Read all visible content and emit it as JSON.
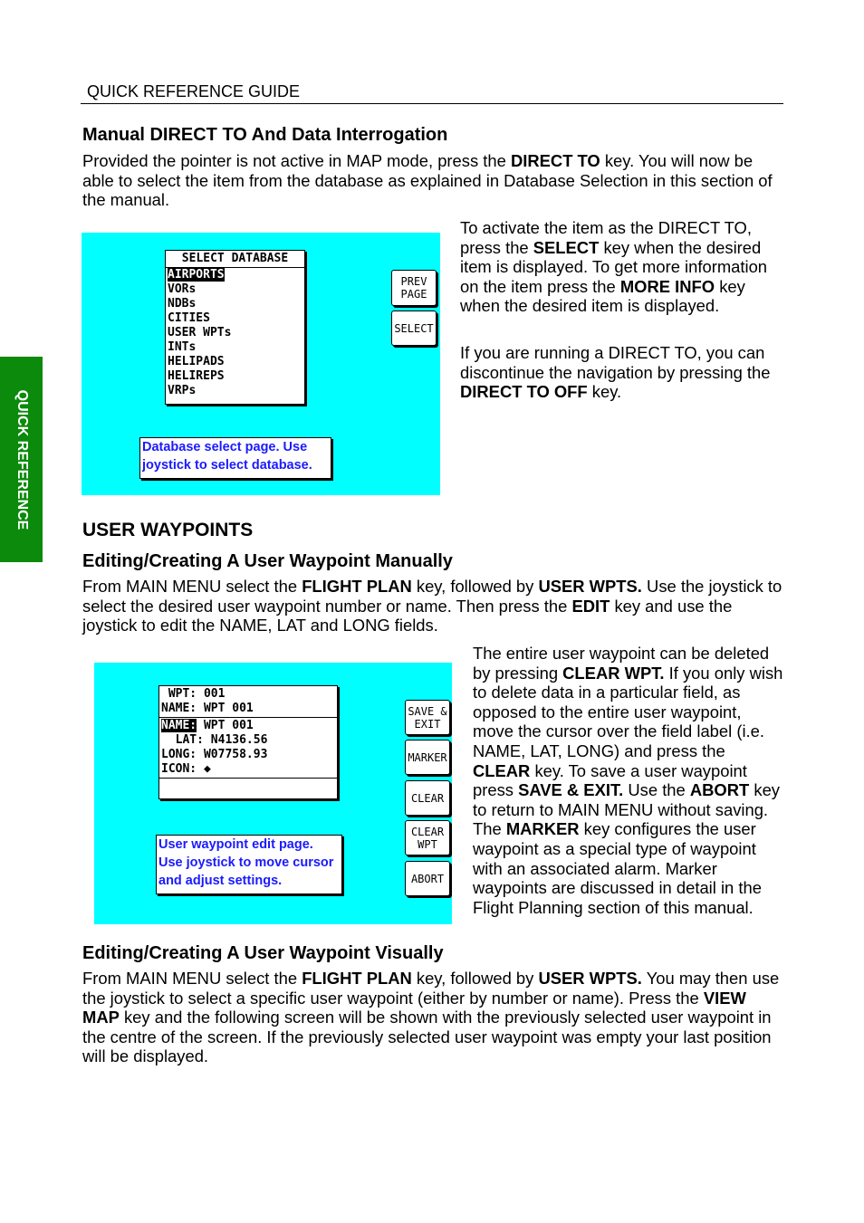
{
  "header": {
    "title": "QUICK REFERENCE GUIDE"
  },
  "side_tab": {
    "label": "QUICK REFERENCE",
    "color": "#0b8a0b"
  },
  "section1": {
    "heading": "Manual DIRECT TO And Data Interrogation",
    "intro": [
      {
        "t": "Provided the pointer is not active in MAP mode, press the "
      },
      {
        "t": "DIRECT TO",
        "b": true
      },
      {
        "t": " key. You will now be able to select the item from the database as explained in Database Selection in this section of the manual."
      }
    ],
    "right_p1": [
      {
        "t": "To activate the item as the DIRECT TO, press the "
      },
      {
        "t": "SELECT",
        "b": true
      },
      {
        "t": " key when the desired item is displayed.  To get more information on the item press the "
      },
      {
        "t": "MORE INFO",
        "b": true
      },
      {
        "t": " key when the desired item is displayed."
      }
    ],
    "right_p2": [
      {
        "t": "If you are running a DIRECT TO, you can discontinue the navigation by pressing the "
      },
      {
        "t": "DIRECT TO OFF",
        "b": true
      },
      {
        "t": " key."
      }
    ],
    "screen": {
      "title": "SELECT DATABASE",
      "items": [
        "AIRPORTS",
        "VORs",
        "NDBs",
        "CITIES",
        "USER WPTs",
        "INTs",
        "HELIPADS",
        "HELIREPS",
        "VRPs"
      ],
      "selected_index": 0,
      "buttons": [
        "PREV\nPAGE",
        "SELECT"
      ],
      "help": "Database select page. Use joystick to select database."
    }
  },
  "section2": {
    "heading": "USER WAYPOINTS",
    "sub1": "Editing/Creating A User Waypoint Manually",
    "intro": [
      {
        "t": "From MAIN MENU select the "
      },
      {
        "t": "FLIGHT PLAN",
        "b": true
      },
      {
        "t": " key, followed by "
      },
      {
        "t": "USER WPTS.",
        "b": true
      },
      {
        "t": " Use the joystick to select the desired user waypoint number or name. Then press the "
      },
      {
        "t": "EDIT",
        "b": true
      },
      {
        "t": " key and use the joystick to edit the NAME, LAT and LONG fields."
      }
    ],
    "right_p": [
      {
        "t": "The entire user waypoint can be deleted by pressing "
      },
      {
        "t": "CLEAR WPT.",
        "b": true
      },
      {
        "t": "  If you only wish to delete data in a particular field, as opposed to the entire user waypoint, move the cursor over the field label (i.e. NAME, LAT, LONG) and press the "
      },
      {
        "t": "CLEAR",
        "b": true
      },
      {
        "t": " key.  To save a user waypoint press "
      },
      {
        "t": "SAVE & EXIT.",
        "b": true
      },
      {
        "t": " Use the "
      },
      {
        "t": "ABORT",
        "b": true
      },
      {
        "t": " key to return to MAIN MENU without saving. The "
      },
      {
        "t": "MARKER",
        "b": true
      },
      {
        "t": " key configures the user waypoint as a special type of waypoint with an associated alarm. Marker waypoints are discussed in detail in the Flight Planning section of this manual."
      }
    ],
    "screen": {
      "top": [
        {
          "label": " WPT:",
          "value": "001"
        },
        {
          "label": "NAME:",
          "value": "WPT 001"
        }
      ],
      "fields": [
        {
          "label": "NAME:",
          "value": "WPT 001",
          "selected": true
        },
        {
          "label": "  LAT:",
          "value": "N4136.56"
        },
        {
          "label": "LONG:",
          "value": "W07758.93"
        },
        {
          "label": "ICON:",
          "value": "◆"
        }
      ],
      "buttons": [
        "SAVE &\nEXIT",
        "MARKER",
        "CLEAR",
        "CLEAR\nWPT",
        "ABORT"
      ],
      "help": "User waypoint edit page. Use joystick to move cursor and adjust settings."
    },
    "sub2": "Editing/Creating A User Waypoint Visually",
    "visual_p": [
      {
        "t": "From MAIN MENU select the "
      },
      {
        "t": "FLIGHT PLAN",
        "b": true
      },
      {
        "t": " key, followed by "
      },
      {
        "t": "USER WPTS.",
        "b": true
      },
      {
        "t": "  You may then use the joystick to select a specific user waypoint (either by number or name).  Press the "
      },
      {
        "t": "VIEW MAP",
        "b": true
      },
      {
        "t": " key and the following screen will be shown with the previously selected user waypoint in the centre of the screen.  If the previously selected user waypoint was empty your last position will be displayed."
      }
    ]
  }
}
